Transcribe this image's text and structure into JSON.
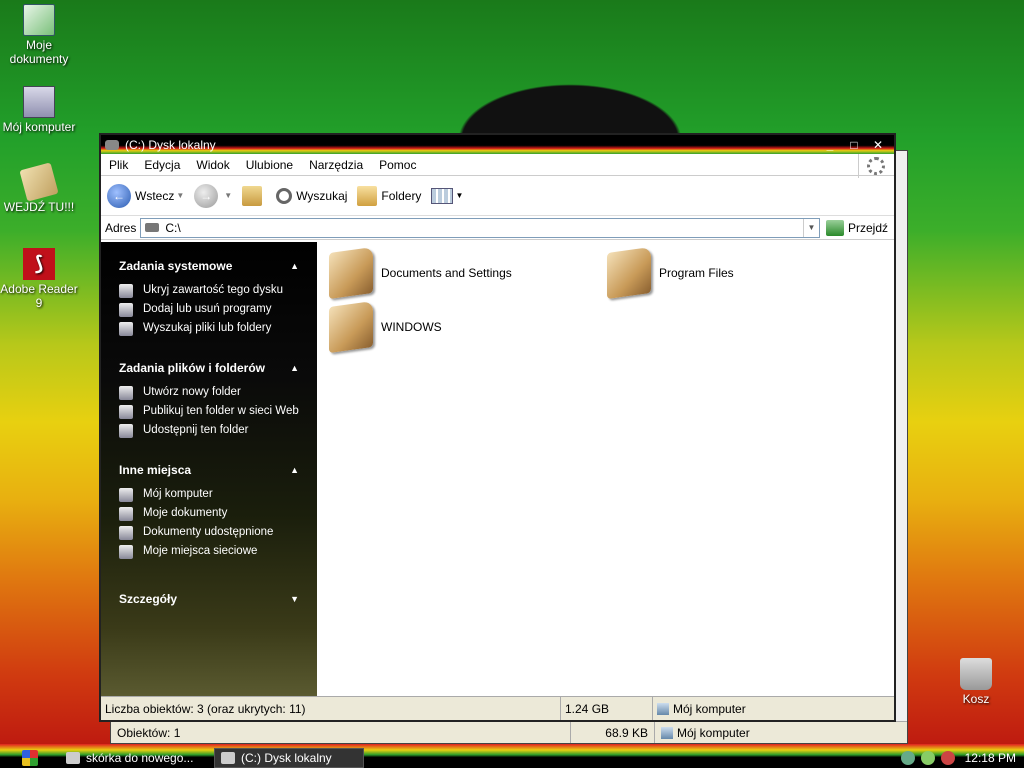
{
  "desktop": {
    "icons": [
      {
        "label": "Moje dokumenty",
        "icon": "my-documents-icon"
      },
      {
        "label": "Mój komputer",
        "icon": "my-computer-icon"
      },
      {
        "label": "WEJDŹ TU!!!",
        "icon": "book-icon"
      },
      {
        "label": "Adobe Reader 9",
        "icon": "pdf-icon"
      },
      {
        "label": "Kosz",
        "icon": "recycle-bin-icon"
      }
    ]
  },
  "back_window": {
    "status": {
      "objects": "Obiektów: 1",
      "size": "68.9 KB",
      "location": "Mój komputer"
    }
  },
  "window": {
    "title": "(C:) Dysk lokalny",
    "menu": [
      "Plik",
      "Edycja",
      "Widok",
      "Ulubione",
      "Narzędzia",
      "Pomoc"
    ],
    "toolbar": {
      "back": "Wstecz",
      "search": "Wyszukaj",
      "folders": "Foldery"
    },
    "address": {
      "label": "Adres",
      "value": "C:\\",
      "go": "Przejdź"
    },
    "tasks": [
      {
        "title": "Zadania systemowe",
        "items": [
          "Ukryj zawartość tego dysku",
          "Dodaj lub usuń programy",
          "Wyszukaj pliki lub foldery"
        ]
      },
      {
        "title": "Zadania plików i folderów",
        "items": [
          "Utwórz nowy folder",
          "Publikuj ten folder w sieci Web",
          "Udostępnij ten folder"
        ]
      },
      {
        "title": "Inne miejsca",
        "items": [
          "Mój komputer",
          "Moje dokumenty",
          "Dokumenty udostępnione",
          "Moje miejsca sieciowe"
        ]
      },
      {
        "title": "Szczegóły",
        "items": []
      }
    ],
    "folders": [
      "Documents and Settings",
      "Program Files",
      "WINDOWS"
    ],
    "status": {
      "count": "Liczba obiektów: 3 (oraz ukrytych: 11)",
      "size": "1.24 GB",
      "location": "Mój komputer"
    }
  },
  "taskbar": {
    "items": [
      {
        "label": "skórka do nowego...",
        "active": false
      },
      {
        "label": "(C:) Dysk lokalny",
        "active": true
      }
    ],
    "clock": "12:18 PM"
  }
}
